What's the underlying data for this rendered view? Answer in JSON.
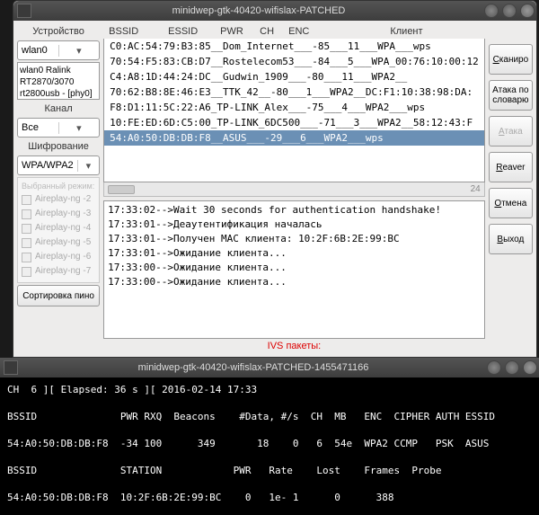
{
  "app_title": "minidwep-gtk-40420-wifislax-PATCHED",
  "left": {
    "device_label": "Устройство",
    "device_value": "wlan0",
    "device_list": [
      "wlan0 Ralink",
      "RT2870/3070",
      "rt2800usb - [phy0]"
    ],
    "channel_label": "Канал",
    "channel_value": "Все",
    "enc_label": "Шифрование",
    "enc_value": "WPA/WPA2",
    "modes_hint": "Выбранный режим:",
    "modes": [
      "Aireplay-ng -2",
      "Aireplay-ng -3",
      "Aireplay-ng -4",
      "Aireplay-ng -5",
      "Aireplay-ng -6",
      "Aireplay-ng -7"
    ],
    "sort_btn": "Сортировка пино"
  },
  "headers": {
    "bssid": "BSSID",
    "essid": "ESSID",
    "pwr": "PWR",
    "ch": "CH",
    "enc": "ENC",
    "client": "Клиент"
  },
  "networks": [
    "C0:AC:54:79:B3:85__Dom_Internet___-85___11___WPA___wps",
    "70:54:F5:83:CB:D7__Rostelecom53___-84___5___WPA_00:76:10:00:12",
    "C4:A8:1D:44:24:DC__Gudwin_1909___-80___11___WPA2__",
    "70:62:B8:8E:46:E3__TTK_42__-80___1___WPA2__DC:F1:10:38:98:DA:",
    "F8:D1:11:5C:22:A6_TP-LINK_Alex___-75___4___WPA2___wps",
    "10:FE:ED:6D:C5:00_TP-LINK_6DC500___-71___3___WPA2__58:12:43:F",
    "54:A0:50:DB:DB:F8__ASUS___-29___6___WPA2___wps"
  ],
  "selected_network": 6,
  "scroll_count": "24",
  "log": [
    "17:33:02-->Wait 30 seconds for authentication handshake!",
    "17:33:01-->Деаутентификация началась",
    "17:33:01-->Получен MAC клиента: 10:2F:6B:2E:99:BC",
    "17:33:01-->Ожидание клиента...",
    "17:33:00-->Ожидание клиента...",
    "17:33:00-->Ожидание клиента..."
  ],
  "ivs": "IVS пакеты:",
  "buttons": {
    "scan": "Сканиро",
    "dict": "Атака по словарю",
    "attack": "Атака",
    "reaver": "Reaver",
    "cancel": "Отмена",
    "exit": "Выход"
  },
  "term_title": "minidwep-gtk-40420-wifislax-PATCHED-1455471166",
  "term_lines": [
    "CH  6 ][ Elapsed: 36 s ][ 2016-02-14 17:33",
    "",
    "BSSID              PWR RXQ  Beacons    #Data, #/s  CH  MB   ENC  CIPHER AUTH ESSID",
    "",
    "54:A0:50:DB:DB:F8  -34 100      349       18    0   6  54e  WPA2 CCMP   PSK  ASUS",
    "",
    "BSSID              STATION            PWR   Rate    Lost    Frames  Probe",
    "",
    "54:A0:50:DB:DB:F8  10:2F:6B:2E:99:BC    0   1e- 1      0      388"
  ]
}
